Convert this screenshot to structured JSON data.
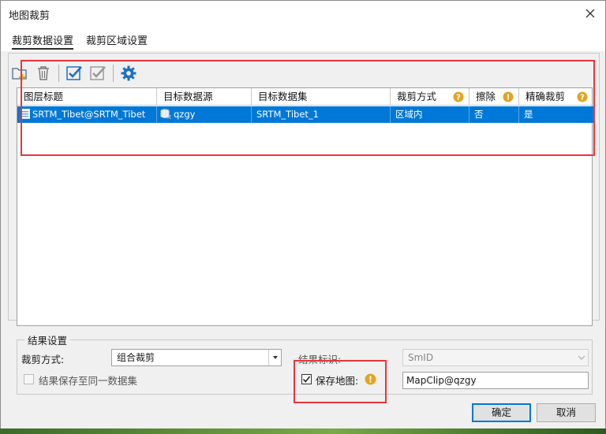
{
  "window": {
    "title": "地图裁剪"
  },
  "tabs": [
    {
      "label": "裁剪数据设置",
      "active": true
    },
    {
      "label": "裁剪区域设置",
      "active": false
    }
  ],
  "toolbar": {
    "icons": [
      "add-layer-icon",
      "delete-icon",
      "select-all-icon",
      "select-invert-icon",
      "settings-icon"
    ]
  },
  "grid": {
    "columns": [
      "图层标题",
      "目标数据源",
      "目标数据集",
      "裁剪方式",
      "擦除",
      "精确裁剪"
    ],
    "rows": [
      {
        "layer": "SRTM_Tibet@SRTM_Tibet",
        "datasource": "qzgy",
        "dataset": "SRTM_Tibet_1",
        "clip_mode": "区域内",
        "erase": "否",
        "exact": "是",
        "selected": true
      }
    ]
  },
  "results": {
    "group_title": "结果设置",
    "clip_mode_label": "裁剪方式:",
    "clip_mode_value": "组合裁剪",
    "result_id_label": "结果标识:",
    "result_id_value": "SmID",
    "save_same_dataset_label": "结果保存至同一数据集",
    "save_same_dataset_checked": false,
    "save_map_label": "保存地图:",
    "save_map_checked": true,
    "map_name_value": "MapClip@qzgy"
  },
  "buttons": {
    "ok": "确定",
    "cancel": "取消"
  },
  "colors": {
    "selection": "#0078d7",
    "highlight": "#e8353b",
    "help_icon": "#e0a526",
    "accent_icon": "#1f6fc4"
  }
}
